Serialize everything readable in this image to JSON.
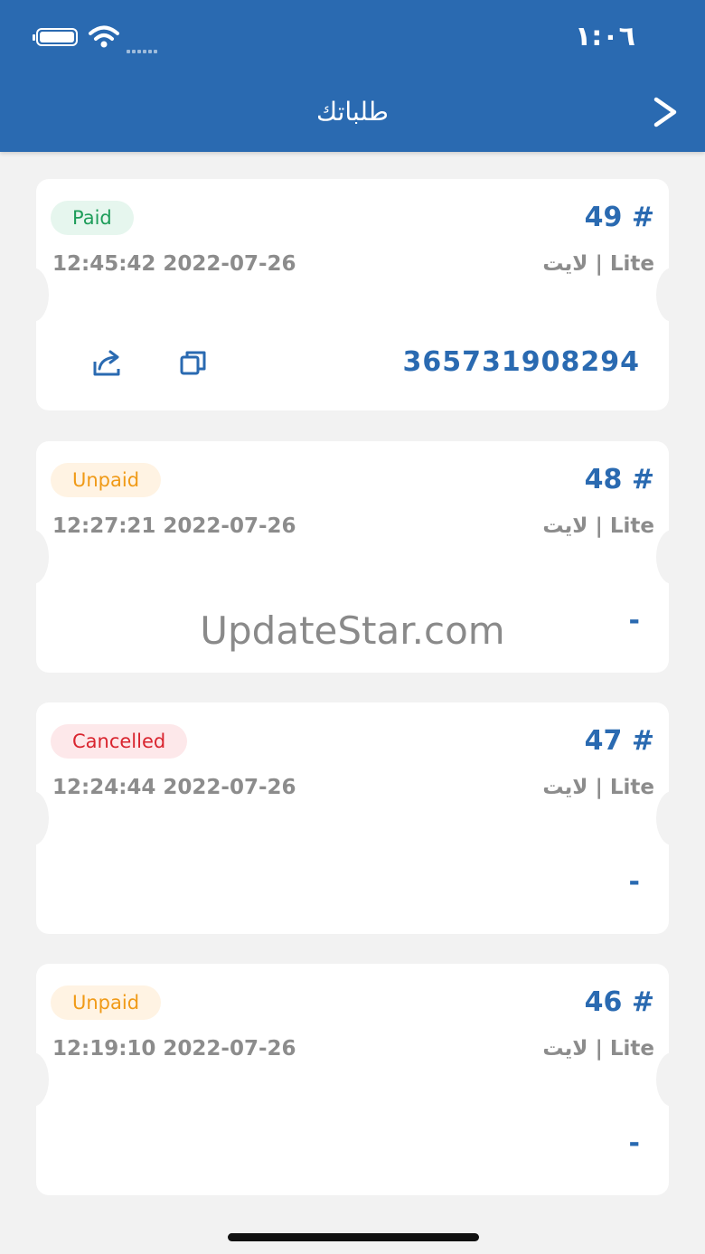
{
  "status_bar": {
    "time": "١:٠٦"
  },
  "header": {
    "title": "طلباتك",
    "back_icon": "chevron-right-icon"
  },
  "orders": [
    {
      "number": "49 #",
      "status": "Paid",
      "timestamp": "12:45:42 2022-07-26",
      "plan": "لايت | Lite",
      "code": "365731908294"
    },
    {
      "number": "48 #",
      "status": "Unpaid",
      "timestamp": "12:27:21 2022-07-26",
      "plan": "لايت | Lite",
      "code": "-"
    },
    {
      "number": "47 #",
      "status": "Cancelled",
      "timestamp": "12:24:44 2022-07-26",
      "plan": "لايت | Lite",
      "code": "-"
    },
    {
      "number": "46 #",
      "status": "Unpaid",
      "timestamp": "12:19:10 2022-07-26",
      "plan": "لايت | Lite",
      "code": "-"
    }
  ],
  "icons": {
    "copy": "copy-icon",
    "share": "share-icon"
  },
  "watermark": "UpdateStar.com",
  "colors": {
    "brand": "#2a6ab1",
    "paid": "#1e9d5a",
    "unpaid": "#f09a17",
    "cancelled": "#d9252f"
  }
}
